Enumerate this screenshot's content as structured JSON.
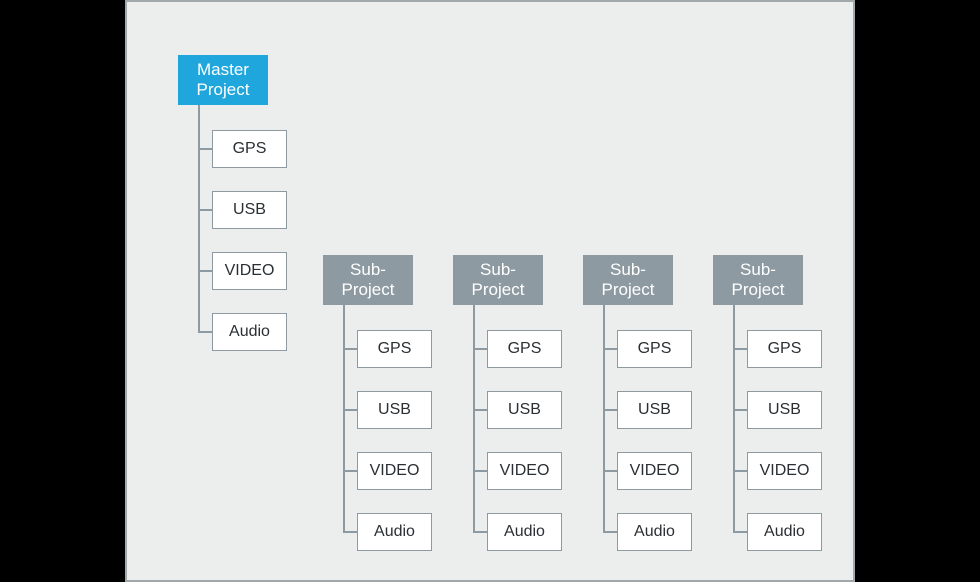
{
  "diagram": {
    "master": {
      "line1": "Master",
      "line2": "Project",
      "children": [
        "GPS",
        "USB",
        "VIDEO",
        "Audio"
      ]
    },
    "subProjects": [
      {
        "line1": "Sub-",
        "line2": "Project",
        "children": [
          "GPS",
          "USB",
          "VIDEO",
          "Audio"
        ]
      },
      {
        "line1": "Sub-",
        "line2": "Project",
        "children": [
          "GPS",
          "USB",
          "VIDEO",
          "Audio"
        ]
      },
      {
        "line1": "Sub-",
        "line2": "Project",
        "children": [
          "GPS",
          "USB",
          "VIDEO",
          "Audio"
        ]
      },
      {
        "line1": "Sub-",
        "line2": "Project",
        "children": [
          "GPS",
          "USB",
          "VIDEO",
          "Audio"
        ]
      }
    ],
    "colors": {
      "masterBg": "#1ea6dd",
      "subBg": "#8e9aa1",
      "leafBorder": "#8e9aa1",
      "canvasBg": "#eceeee",
      "outerBg": "#000000"
    }
  }
}
